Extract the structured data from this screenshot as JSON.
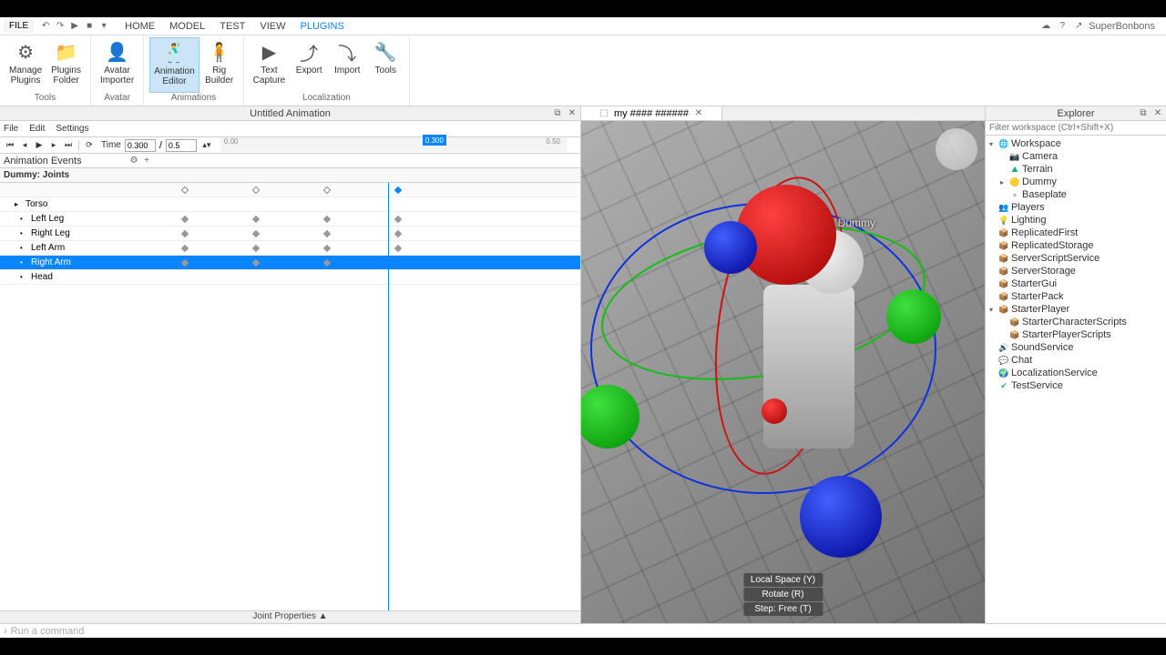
{
  "menubar": {
    "file": "FILE",
    "tabs": [
      "HOME",
      "MODEL",
      "TEST",
      "VIEW",
      "PLUGINS"
    ],
    "active_tab": 4,
    "username": "SuperBonbons"
  },
  "ribbon": {
    "groups": [
      {
        "label": "Tools",
        "items": [
          {
            "icon": "⚙",
            "label": "Manage\nPlugins"
          },
          {
            "icon": "📁",
            "label": "Plugins\nFolder"
          }
        ]
      },
      {
        "label": "Avatar",
        "items": [
          {
            "icon": "👤",
            "label": "Avatar\nImporter"
          }
        ]
      },
      {
        "label": "Animations",
        "items": [
          {
            "icon": "🕺",
            "label": "Animation\nEditor",
            "active": true
          },
          {
            "icon": "🧍",
            "label": "Rig\nBuilder"
          }
        ]
      },
      {
        "label": "Localization",
        "items": [
          {
            "icon": "▶",
            "label": "Text\nCapture"
          },
          {
            "icon": "⤴",
            "label": "Export"
          },
          {
            "icon": "⤵",
            "label": "Import"
          },
          {
            "icon": "🔧",
            "label": "Tools"
          }
        ]
      }
    ]
  },
  "animation_panel": {
    "title": "Untitled Animation",
    "menu": [
      "File",
      "Edit",
      "Settings"
    ],
    "time_label": "Time",
    "time_value": "0.300",
    "time_max": "0.5",
    "ruler": {
      "t0": "0.00",
      "marker": "0.300",
      "t_end": "0.50"
    },
    "events_label": "Animation Events",
    "header": "Dummy: Joints",
    "joints": [
      {
        "name": "Torso",
        "child": false,
        "keys": []
      },
      {
        "name": "Left Leg",
        "child": true,
        "keys": [
          0,
          1,
          2,
          3
        ]
      },
      {
        "name": "Right Leg",
        "child": true,
        "keys": [
          0,
          1,
          2,
          3
        ]
      },
      {
        "name": "Left Arm",
        "child": true,
        "keys": [
          0,
          1,
          2,
          3
        ]
      },
      {
        "name": "Right Arm",
        "child": true,
        "keys": [
          0,
          1,
          2,
          3
        ],
        "selected": true
      },
      {
        "name": "Head",
        "child": true,
        "keys": []
      }
    ],
    "summary_keys": [
      0,
      1,
      2,
      3
    ],
    "joint_props": "Joint Properties  ▲"
  },
  "viewport": {
    "tab": "my #### ######",
    "overlay": [
      "Local Space (Y)",
      "Rotate (R)",
      "Step: Free (T)"
    ],
    "character_label": "Dummy"
  },
  "explorer": {
    "title": "Explorer",
    "filter_placeholder": "Filter workspace (Ctrl+Shift+X)",
    "items": [
      {
        "label": "Workspace",
        "indent": 0,
        "expand": "▾",
        "icon": "🌐",
        "color": "#3a76d0"
      },
      {
        "label": "Camera",
        "indent": 1,
        "expand": "",
        "icon": "📷"
      },
      {
        "label": "Terrain",
        "indent": 1,
        "expand": "",
        "icon": "⛰",
        "color": "#2a8"
      },
      {
        "label": "Dummy",
        "indent": 1,
        "expand": "▸",
        "icon": "🟡"
      },
      {
        "label": "Baseplate",
        "indent": 1,
        "expand": "",
        "icon": "▫"
      },
      {
        "label": "Players",
        "indent": 0,
        "expand": "",
        "icon": "👥"
      },
      {
        "label": "Lighting",
        "indent": 0,
        "expand": "",
        "icon": "💡"
      },
      {
        "label": "ReplicatedFirst",
        "indent": 0,
        "expand": "",
        "icon": "📦"
      },
      {
        "label": "ReplicatedStorage",
        "indent": 0,
        "expand": "",
        "icon": "📦"
      },
      {
        "label": "ServerScriptService",
        "indent": 0,
        "expand": "",
        "icon": "📦"
      },
      {
        "label": "ServerStorage",
        "indent": 0,
        "expand": "",
        "icon": "📦"
      },
      {
        "label": "StarterGui",
        "indent": 0,
        "expand": "",
        "icon": "📦"
      },
      {
        "label": "StarterPack",
        "indent": 0,
        "expand": "",
        "icon": "📦"
      },
      {
        "label": "StarterPlayer",
        "indent": 0,
        "expand": "▾",
        "icon": "📦"
      },
      {
        "label": "StarterCharacterScripts",
        "indent": 1,
        "expand": "",
        "icon": "📦"
      },
      {
        "label": "StarterPlayerScripts",
        "indent": 1,
        "expand": "",
        "icon": "📦"
      },
      {
        "label": "SoundService",
        "indent": 0,
        "expand": "",
        "icon": "🔊"
      },
      {
        "label": "Chat",
        "indent": 0,
        "expand": "",
        "icon": "💬"
      },
      {
        "label": "LocalizationService",
        "indent": 0,
        "expand": "",
        "icon": "🌍"
      },
      {
        "label": "TestService",
        "indent": 0,
        "expand": "",
        "icon": "✔",
        "color": "#2a8"
      }
    ]
  },
  "command_bar": {
    "placeholder": "Run a command"
  }
}
